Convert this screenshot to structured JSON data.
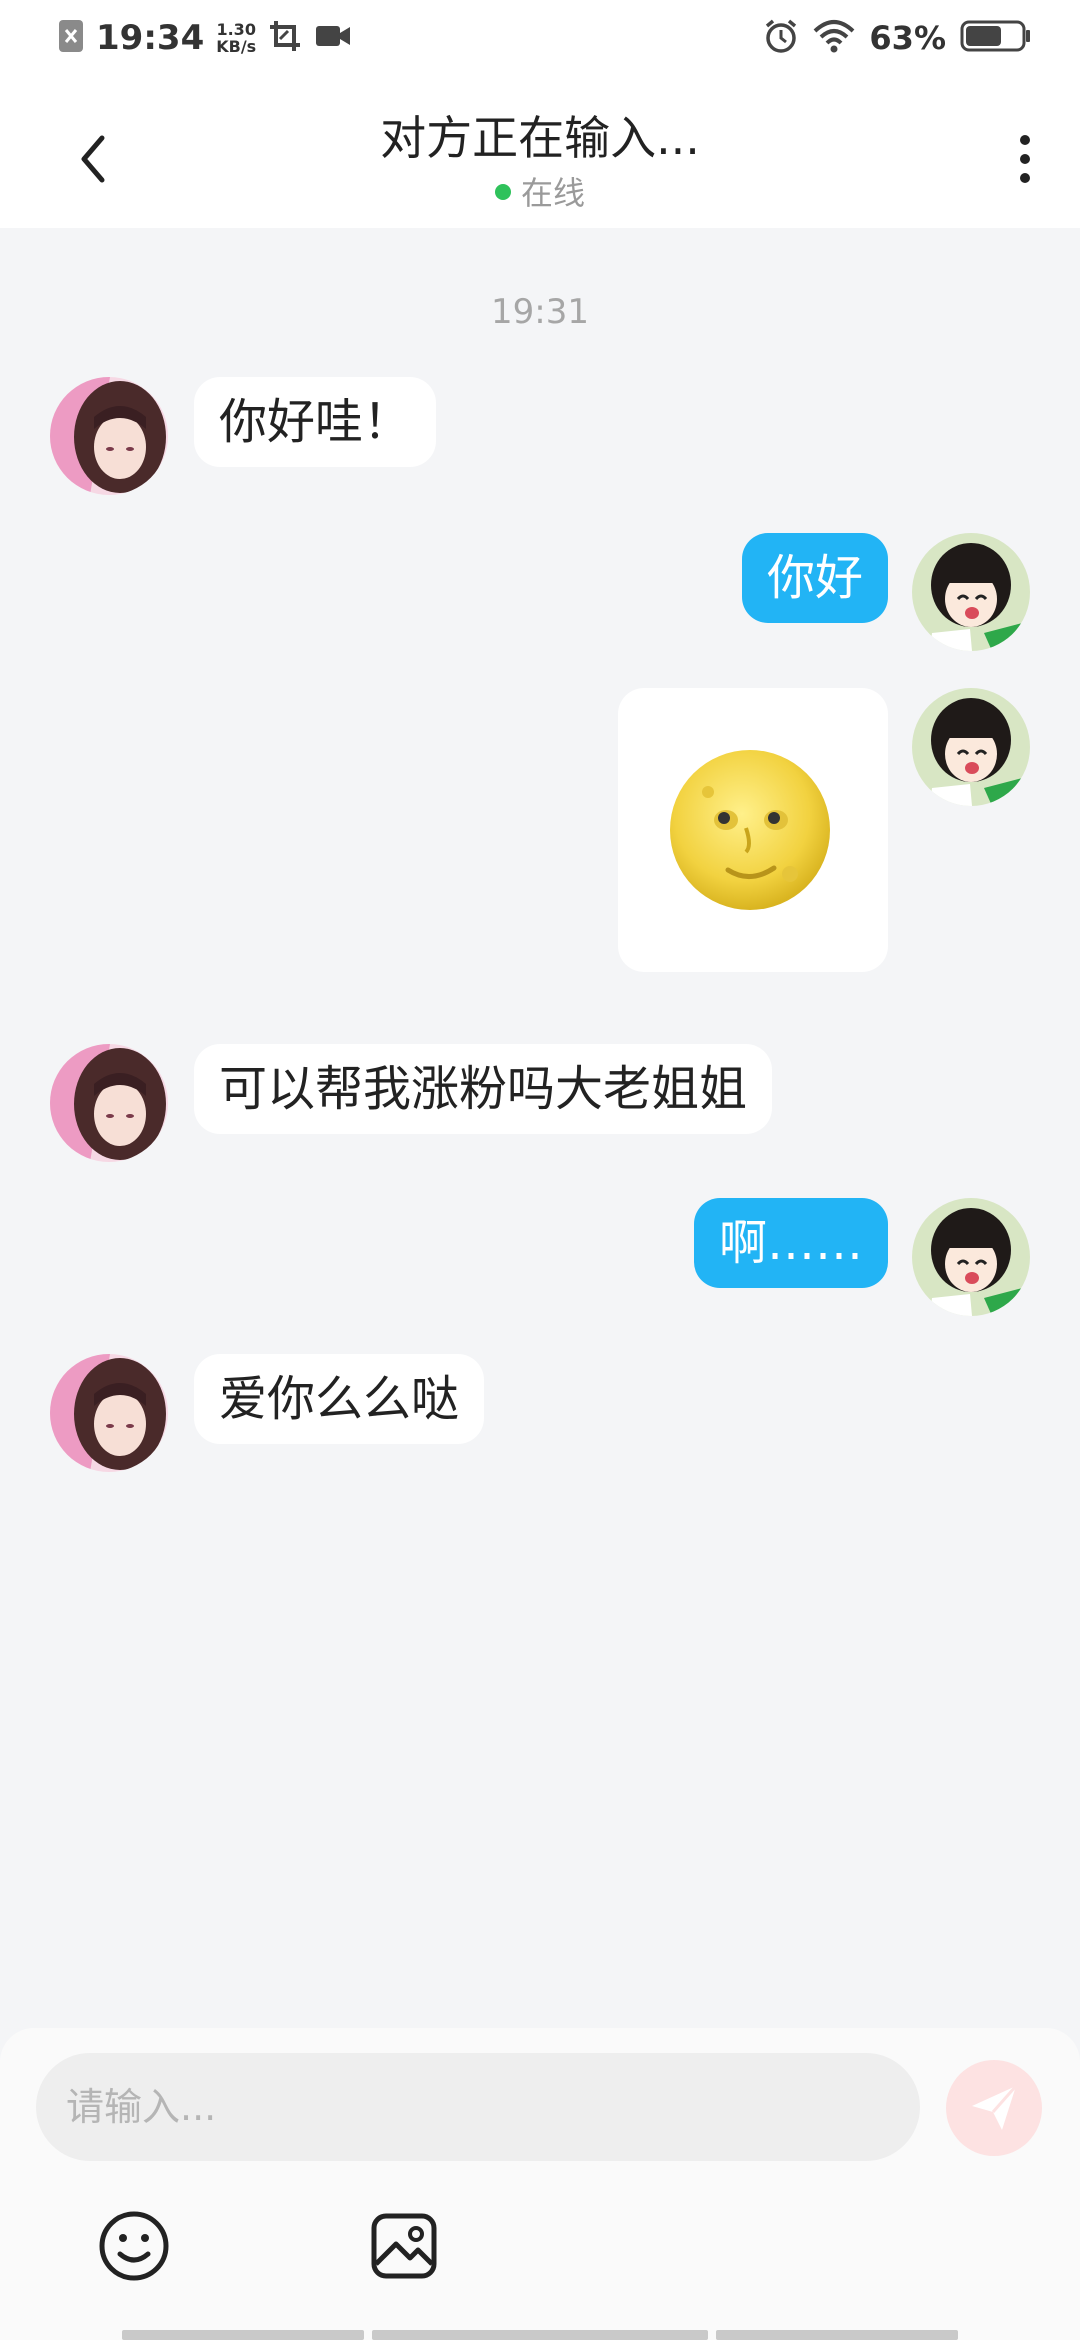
{
  "status_bar": {
    "time": "19:34",
    "speed_value": "1.30",
    "speed_unit": "KB/s",
    "battery_percent": "63%",
    "battery_level": 0.63,
    "icons": [
      "notification-x-icon",
      "screenshot-icon",
      "video-icon",
      "alarm-icon",
      "wifi-icon",
      "battery-icon"
    ]
  },
  "header": {
    "title": "对方正在输入...",
    "status": "在线",
    "status_color": "#2fc25b"
  },
  "chat": {
    "time_divider": "19:31",
    "messages": [
      {
        "side": "left",
        "type": "text",
        "text": "你好哇！"
      },
      {
        "side": "right",
        "type": "text",
        "text": "你好"
      },
      {
        "side": "right",
        "type": "image",
        "content": "moon-face-emoji"
      },
      {
        "side": "left",
        "type": "text",
        "text": "可以帮我涨粉吗大老姐姐"
      },
      {
        "side": "right",
        "type": "text",
        "text": "啊……"
      },
      {
        "side": "left",
        "type": "text",
        "text": "爱你么么哒"
      }
    ],
    "outgoing_bubble_color": "#22b4f5",
    "incoming_bubble_color": "#ffffff"
  },
  "input": {
    "placeholder": "请输入...",
    "value": "",
    "tools": [
      "emoji-icon",
      "image-icon"
    ],
    "send_icon": "paper-plane-icon"
  }
}
